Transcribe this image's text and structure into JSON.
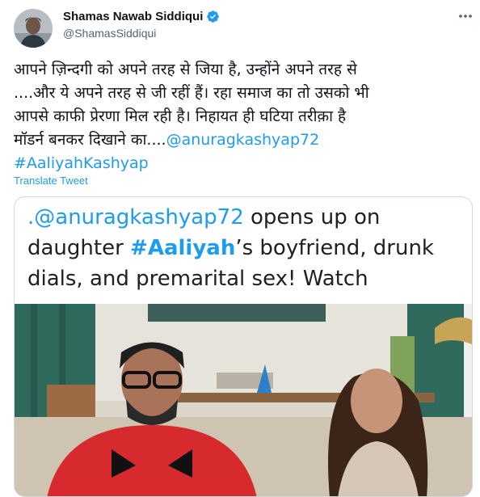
{
  "author": {
    "name": "Shamas Nawab Siddiqui",
    "handle": "@ShamasSiddiqui"
  },
  "tweet": {
    "lines": [
      "आपने ज़िन्दगी को अपने तरह से जिया है, उन्होंने अपने तरह से",
      "....और ये अपने तरह से जी रहीं हैं। रहा समाज का तो उसको भी",
      "आपसे काफी प्रेरणा मिल रही है। निहायत ही घटिया तरीक़ा है"
    ],
    "line4_text": "मॉडर्न बनकर दिखाने का....",
    "mention": "@anuragkashyap72",
    "hashtag": "#AaliyahKashyap",
    "translate_label": "Translate Tweet"
  },
  "card": {
    "line1_mention": ".@anuragkashyap72",
    "line1_rest": " opens up on",
    "line2_pre": "daughter ",
    "line2_hashtag": "#Aaliyah",
    "line2_rest": "’s boyfriend, drunk",
    "line3": "dials, and premarital sex! Watch"
  },
  "colors": {
    "link": "#1d9bf0",
    "text": "#0f1419",
    "muted": "#536471",
    "border": "#cfd9de"
  },
  "icons": [
    "verified-badge-icon",
    "more-options-icon"
  ]
}
